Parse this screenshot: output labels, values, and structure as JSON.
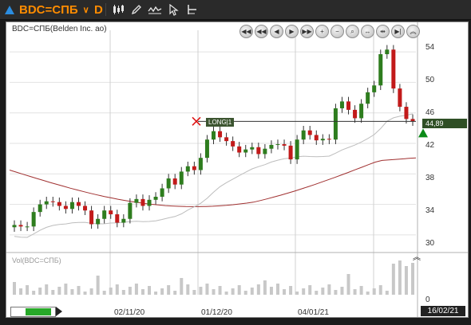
{
  "toolbar": {
    "ticker": "BDC=СПБ",
    "period": "D",
    "tools": [
      "candlestick-chart-icon",
      "draw-pencil-icon",
      "indicator-wave-icon",
      "pointer-cursor-icon",
      "chart-settings-icon"
    ]
  },
  "chart": {
    "title": "BDC=СПБ(Belden Inc. ao)",
    "volume_title": "Vol(BDC=СПБ)",
    "last_price_label": "44,89",
    "signal_label": "LONG|1",
    "end_date": "16/02/21",
    "y_ticks": [
      "54",
      "50",
      "46",
      "42",
      "38",
      "34",
      "30"
    ],
    "x_ticks": [
      "02/11/20",
      "01/12/20",
      "04/01/21"
    ],
    "volume_tick": "0",
    "colors": {
      "up": "#2e7d1e",
      "down": "#c21a1a",
      "ma_long": "#a03030",
      "ma_short": "#bdbdbd",
      "accent": "#ff8c00"
    }
  },
  "chart_data": {
    "type": "candlestick",
    "ylim": [
      28,
      56
    ],
    "ohlc_close": [
      31.3,
      31.1,
      31.1,
      33,
      34,
      34.4,
      34.3,
      33.8,
      33.4,
      34.3,
      33.8,
      33.2,
      31.4,
      32.1,
      33.2,
      32.7,
      31.6,
      32.1,
      34.2,
      34.7,
      33.8,
      34.6,
      35,
      36.1,
      37.4,
      36.6,
      38.3,
      39,
      38.5,
      40.1,
      42.5,
      43.6,
      42.8,
      42.3,
      41.6,
      40.8,
      41.2,
      41.5,
      40.6,
      41.3,
      41.8,
      41.9,
      41.7,
      39.9,
      42.5,
      43.7,
      43.1,
      42.4,
      42.6,
      42.5,
      46.6,
      47.5,
      46.4,
      45.3,
      47.2,
      48.7,
      49.6,
      53.7,
      54.3,
      49.2,
      46.8,
      45.2,
      44.9
    ],
    "annotations": [
      "LONG|1"
    ],
    "last_price": 44.89
  }
}
